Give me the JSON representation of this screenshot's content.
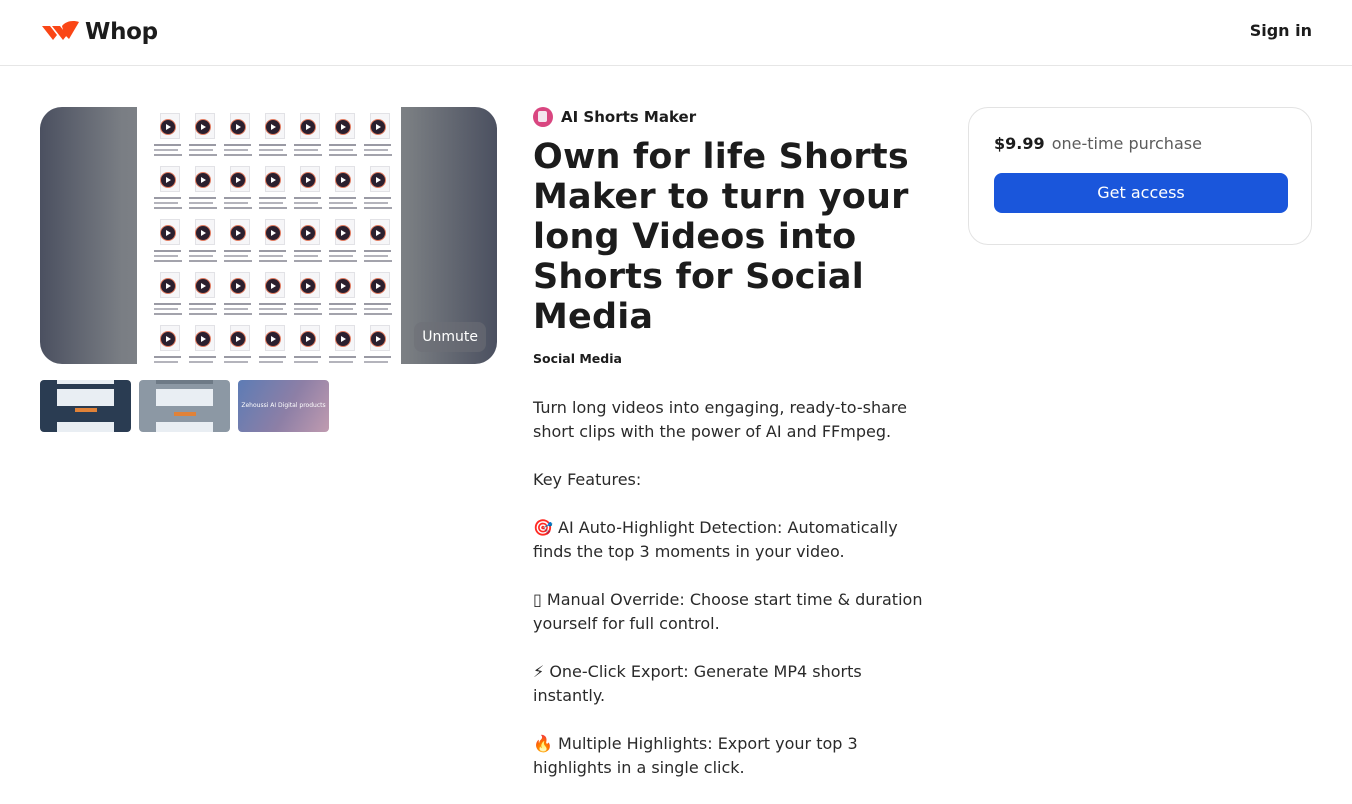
{
  "header": {
    "logo_text": "Whop",
    "sign_in_label": "Sign in"
  },
  "media": {
    "unmute_label": "Unmute",
    "thumbnails": [
      {
        "caption": ""
      },
      {
        "caption": ""
      },
      {
        "caption": "Zehoussi AI Digital products"
      }
    ]
  },
  "product": {
    "name": "AI Shorts Maker",
    "title": "Own for life Shorts Maker to turn your long Videos into Shorts for Social Media",
    "category": "Social Media",
    "description": [
      "Turn long videos into engaging, ready-to-share short clips with the power of AI and FFmpeg.",
      "Key Features:",
      "🎯 AI Auto-Highlight Detection: Automatically finds the top 3 moments in your video.",
      "▯ Manual Override: Choose start time & duration yourself for full control.",
      "⚡ One-Click Export: Generate MP4 shorts instantly.",
      "🔥 Multiple Highlights: Export your top 3 highlights in a single click."
    ]
  },
  "purchase": {
    "price": "$9.99",
    "price_note": "one-time purchase",
    "cta_label": "Get access"
  },
  "colors": {
    "brand_red": "#fa4616",
    "cta_blue": "#1a56db",
    "product_icon": "#d94680"
  }
}
